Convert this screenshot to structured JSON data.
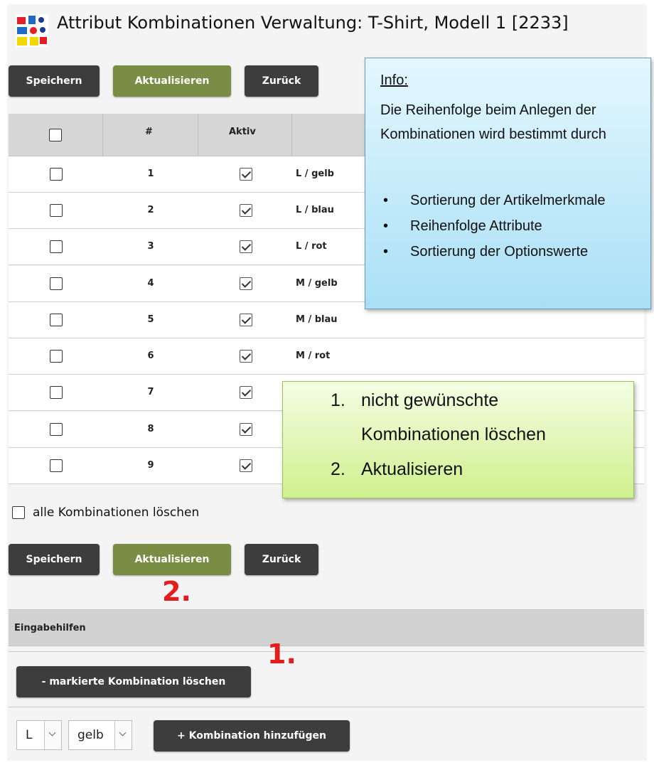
{
  "header": {
    "title": "Attribut Kombinationen Verwaltung: T-Shirt, Modell 1 [2233]"
  },
  "buttons": {
    "save": "Speichern",
    "update": "Aktualisieren",
    "back": "Zurück",
    "delete_marked": "- markierte Kombination löschen",
    "add_combination": "+ Kombination hinzufügen"
  },
  "table": {
    "headers": {
      "num": "#",
      "active": "Aktiv"
    },
    "rows": [
      {
        "num": "1",
        "combo": "L / gelb",
        "active": true
      },
      {
        "num": "2",
        "combo": "L / blau",
        "active": true
      },
      {
        "num": "3",
        "combo": "L / rot",
        "active": true
      },
      {
        "num": "4",
        "combo": "M / gelb",
        "active": true
      },
      {
        "num": "5",
        "combo": "M / blau",
        "active": true
      },
      {
        "num": "6",
        "combo": "M / rot",
        "active": true
      },
      {
        "num": "7",
        "combo": "",
        "active": true
      },
      {
        "num": "8",
        "combo": "",
        "active": true
      },
      {
        "num": "9",
        "combo": "",
        "active": true
      }
    ]
  },
  "delete_all": {
    "label": "alle Kombinationen löschen",
    "checked": false
  },
  "info": {
    "title": "Info:",
    "text": "Die Reihenfolge beim Anlegen der Kombinationen wird bestimmt durch",
    "items": [
      "Sortierung der Artikelmerkmale",
      "Reihenfolge Attribute",
      "Sortierung der Optionswerte"
    ]
  },
  "steps": {
    "step1_num": "1.",
    "step1_line1": "nicht gewünschte",
    "step1_line2": "Kombinationen löschen",
    "step2_num": "2.",
    "step2_text": "Aktualisieren"
  },
  "annotations": {
    "marker_update": "2.",
    "marker_delete": "1."
  },
  "section": {
    "title": "Eingabehilfen"
  },
  "selects": {
    "size": "L",
    "color": "gelb"
  },
  "colors": {
    "button_dark": "#3d3d3d",
    "button_green": "#7a8d45",
    "annotation_red": "#e41c1c"
  }
}
